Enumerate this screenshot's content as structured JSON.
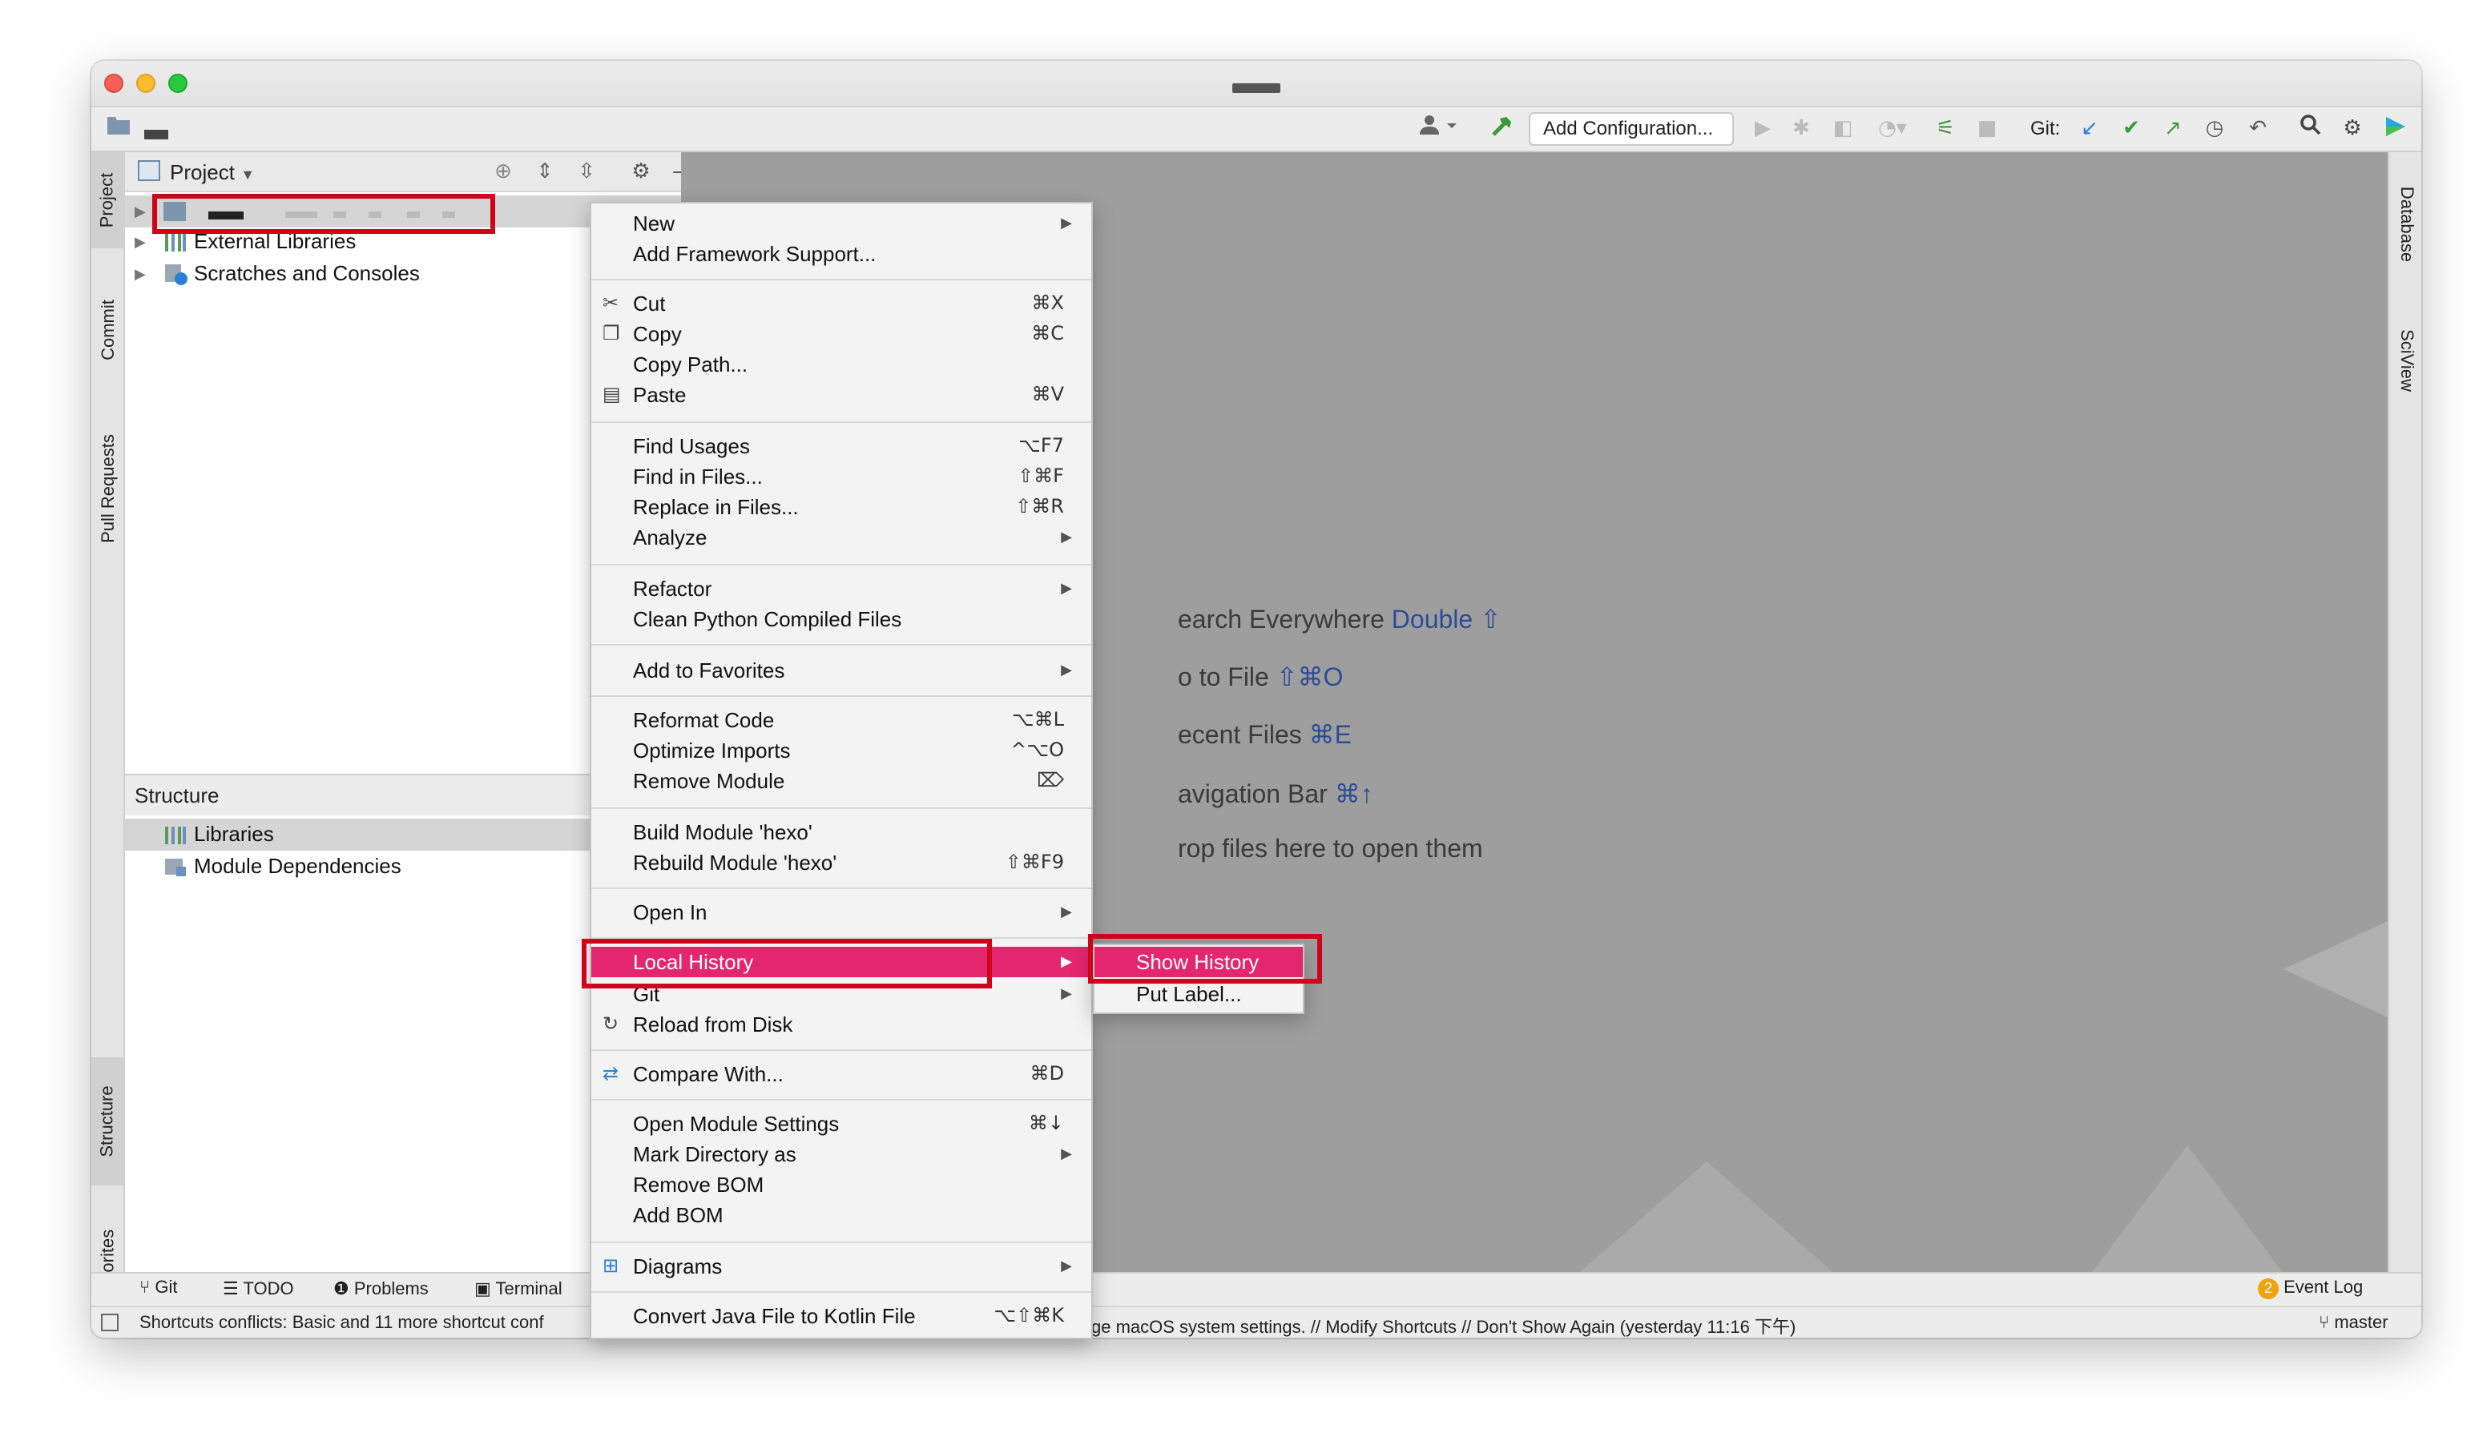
{
  "window": {
    "title_redacted": true
  },
  "navbar": {
    "run_config": "Add Configuration...",
    "git_label": "Git:"
  },
  "project_panel": {
    "title": "Project",
    "tree": [
      {
        "label": "",
        "redacted": true
      },
      {
        "label": "External Libraries"
      },
      {
        "label": "Scratches and Consoles"
      }
    ]
  },
  "left_tabs": [
    "Project",
    "Commit",
    "Pull Requests",
    "Structure",
    "Favorites"
  ],
  "right_tabs": [
    "Database",
    "SciView"
  ],
  "structure_panel": {
    "title": "Structure",
    "items": [
      "Libraries",
      "Module Dependencies"
    ]
  },
  "editor_hints": [
    {
      "text": "earch Everywhere ",
      "key": "Double ⇧"
    },
    {
      "text": "o to File ",
      "key": "⇧⌘O"
    },
    {
      "text": "ecent Files ",
      "key": "⌘E"
    },
    {
      "text": "avigation Bar ",
      "key": "⌘↑"
    },
    {
      "text": "rop files here to open them",
      "key": ""
    }
  ],
  "context_menu": {
    "items": [
      {
        "label": "New",
        "submenu": true
      },
      {
        "label": "Add Framework Support..."
      },
      {
        "label": "Cut",
        "shortcut": "⌘X",
        "icon": "cut-icon"
      },
      {
        "label": "Copy",
        "shortcut": "⌘C",
        "icon": "copy-icon"
      },
      {
        "label": "Copy Path..."
      },
      {
        "label": "Paste",
        "shortcut": "⌘V",
        "icon": "paste-icon"
      },
      {
        "label": "Find Usages",
        "shortcut": "⌥F7"
      },
      {
        "label": "Find in Files...",
        "shortcut": "⇧⌘F"
      },
      {
        "label": "Replace in Files...",
        "shortcut": "⇧⌘R"
      },
      {
        "label": "Analyze",
        "submenu": true
      },
      {
        "label": "Refactor",
        "submenu": true
      },
      {
        "label": "Clean Python Compiled Files"
      },
      {
        "label": "Add to Favorites",
        "submenu": true
      },
      {
        "label": "Reformat Code",
        "shortcut": "⌥⌘L"
      },
      {
        "label": "Optimize Imports",
        "shortcut": "^⌥O"
      },
      {
        "label": "Remove Module",
        "shortcut": "⌦"
      },
      {
        "label": "Build Module 'hexo'"
      },
      {
        "label": "Rebuild Module 'hexo'",
        "shortcut": "⇧⌘F9"
      },
      {
        "label": "Open In",
        "submenu": true
      },
      {
        "label": "Local History",
        "submenu": true,
        "active": true
      },
      {
        "label": "Git",
        "submenu": true
      },
      {
        "label": "Reload from Disk",
        "icon": "reload-icon"
      },
      {
        "label": "Compare With...",
        "shortcut": "⌘D",
        "icon": "compare-icon"
      },
      {
        "label": "Open Module Settings",
        "shortcut": "⌘↓"
      },
      {
        "label": "Mark Directory as",
        "submenu": true
      },
      {
        "label": "Remove BOM"
      },
      {
        "label": "Add BOM"
      },
      {
        "label": "Diagrams",
        "submenu": true,
        "icon": "diagram-icon"
      },
      {
        "label": "Convert Java File to Kotlin File",
        "shortcut": "⌥⇧⌘K"
      }
    ]
  },
  "local_history_submenu": {
    "items": [
      {
        "label": "Show History",
        "active": true
      },
      {
        "label": "Put Label..."
      }
    ]
  },
  "bottom_tabs": [
    "Git",
    "TODO",
    "Problems",
    "Terminal"
  ],
  "event_log": {
    "label": "Event Log",
    "count": "2"
  },
  "status": {
    "left": "Shortcuts conflicts: Basic and 11 more shortcut conf",
    "right": "ge macOS system settings. // Modify Shortcuts // Don't Show Again (yesterday 11:16 下午)",
    "branch": "master"
  },
  "colors": {
    "menu_highlight": "#e3266d",
    "annotation": "#d0021b",
    "editor_bg": "#9e9e9e",
    "hint_key": "#2c4c98"
  }
}
